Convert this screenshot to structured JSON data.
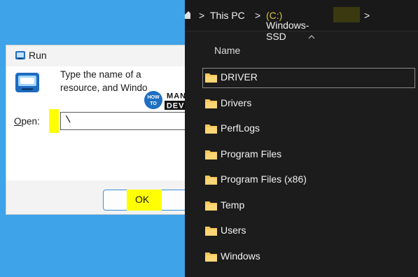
{
  "run_dialog": {
    "title": "Run",
    "description_line1": "Type the name of a",
    "description_line2": "resource, and Windo",
    "open_label_underlined": "O",
    "open_label_rest": "pen:",
    "open_value": "\\",
    "ok_label": "OK"
  },
  "watermark": {
    "how": "HOW",
    "to": "TO",
    "manage": "MANAGE",
    "devices": "DEVICES"
  },
  "explorer": {
    "breadcrumb": {
      "separator": ">",
      "this_pc": "This PC",
      "drive": "Windows-SSD",
      "drive_letter": "(C:)"
    },
    "column_header": "Name",
    "folders": [
      "DRIVER",
      "Drivers",
      "PerfLogs",
      "Program Files",
      "Program Files (x86)",
      "Temp",
      "Users",
      "Windows"
    ],
    "colors": {
      "folder": "#f6c75a",
      "highlight": "#ffff00",
      "background": "#1c1c1c"
    }
  }
}
